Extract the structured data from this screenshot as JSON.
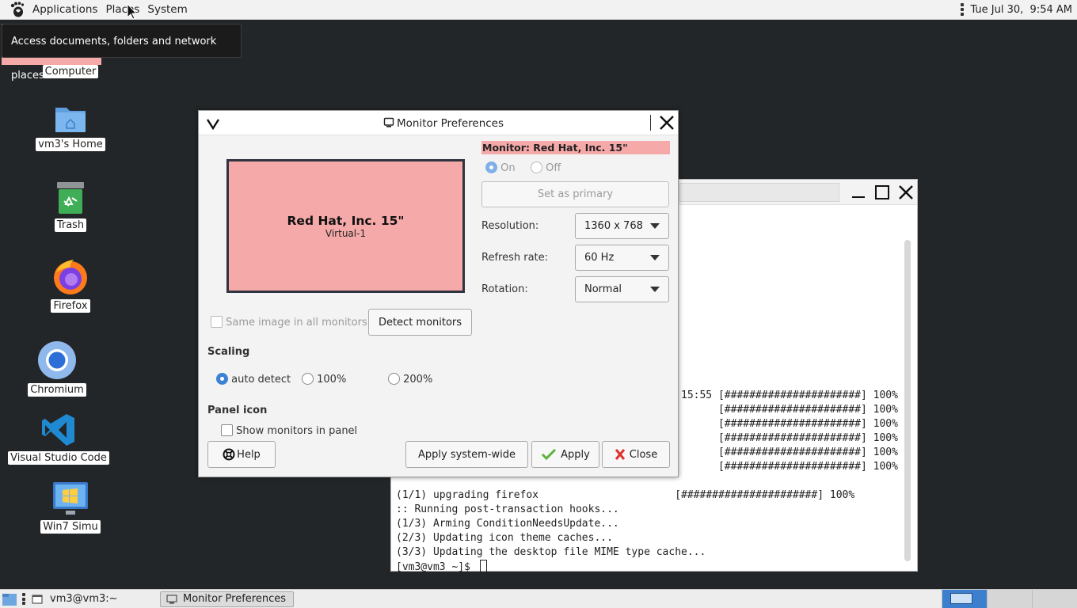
{
  "topbar": {
    "menus": [
      "Applications",
      "Places",
      "System"
    ],
    "clock": "Tue Jul 30,  9:54 AM"
  },
  "tooltip": "Access documents, folders and network places",
  "desktop_icons": [
    {
      "label": "Computer",
      "icon": "computer-icon"
    },
    {
      "label": "vm3's Home",
      "icon": "home-folder-icon"
    },
    {
      "label": "Trash",
      "icon": "trash-icon"
    },
    {
      "label": "Firefox",
      "icon": "firefox-icon"
    },
    {
      "label": "Chromium",
      "icon": "chromium-icon"
    },
    {
      "label": "Visual Studio Code",
      "icon": "vscode-icon"
    },
    {
      "label": "Win7 Simu",
      "icon": "win7-icon"
    }
  ],
  "terminal": {
    "lines": [
      "15:55 [######################] 100%",
      "      [######################] 100%",
      "      [######################] 100%",
      "      [######################] 100%",
      "      [######################] 100%",
      "      [######################] 100%",
      "(1/1) upgrading firefox                      [######################] 100%",
      ":: Running post-transaction hooks...",
      "(1/3) Arming ConditionNeedsUpdate...",
      "(2/3) Updating icon theme caches...",
      "(3/3) Updating the desktop file MIME type cache...",
      "[vm3@vm3 ~]$ "
    ]
  },
  "dialog": {
    "title": "Monitor Preferences",
    "monitor_header": "Monitor: Red Hat, Inc. 15\"",
    "monitor_name": "Red Hat, Inc. 15\"",
    "monitor_sub": "Virtual-1",
    "on_label": "On",
    "off_label": "Off",
    "set_primary": "Set as primary",
    "resolution_label": "Resolution:",
    "resolution_value": "1360 x 768",
    "refresh_label": "Refresh rate:",
    "refresh_value": "60 Hz",
    "rotation_label": "Rotation:",
    "rotation_value": "Normal",
    "same_image": "Same image in all monitors",
    "detect": "Detect monitors",
    "scaling_title": "Scaling",
    "scaling_options": [
      "auto detect",
      "100%",
      "200%"
    ],
    "scaling_selected": "auto detect",
    "panel_icon_title": "Panel icon",
    "show_monitors": "Show monitors in panel",
    "help": "Help",
    "apply_system_wide": "Apply system-wide",
    "apply": "Apply",
    "close": "Close"
  },
  "taskbar": {
    "terminal_task": "vm3@vm3:~",
    "dialog_task": "Monitor Preferences"
  },
  "colors": {
    "selection": "#f6a9a9",
    "accent": "#3b82d6",
    "desktop": "#232628"
  }
}
